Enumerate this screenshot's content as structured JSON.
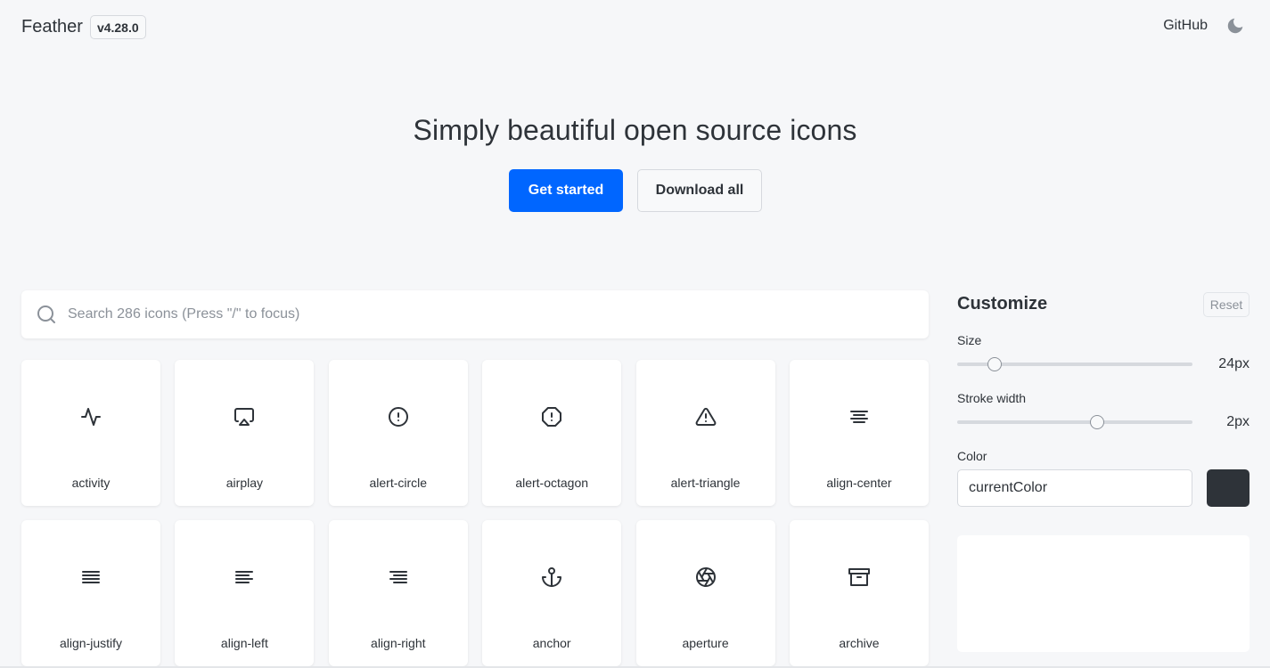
{
  "header": {
    "brand": "Feather",
    "version": "v4.28.0",
    "github_label": "GitHub",
    "theme_toggle_icon": "moon-icon"
  },
  "hero": {
    "title": "Simply beautiful open source icons",
    "primary_label": "Get started",
    "secondary_label": "Download all"
  },
  "search": {
    "icon": "search-icon",
    "placeholder": "Search 286 icons (Press \"/\" to focus)",
    "value": ""
  },
  "icons": [
    {
      "name": "activity"
    },
    {
      "name": "airplay"
    },
    {
      "name": "alert-circle"
    },
    {
      "name": "alert-octagon"
    },
    {
      "name": "alert-triangle"
    },
    {
      "name": "align-center"
    },
    {
      "name": "align-justify"
    },
    {
      "name": "align-left"
    },
    {
      "name": "align-right"
    },
    {
      "name": "anchor"
    },
    {
      "name": "aperture"
    },
    {
      "name": "archive"
    }
  ],
  "customize": {
    "title": "Customize",
    "reset_label": "Reset",
    "size": {
      "label": "Size",
      "value_label": "24px",
      "value": 24,
      "min": 12,
      "max": 100
    },
    "stroke": {
      "label": "Stroke width",
      "value_label": "2px",
      "value": 2,
      "min": 0.5,
      "max": 3
    },
    "color": {
      "label": "Color",
      "value": "currentColor",
      "swatch": "#2e3339"
    }
  },
  "colors": {
    "accent": "#0066ff",
    "text": "#2e3339",
    "muted": "#8b9199",
    "background": "#f6f7f9"
  }
}
